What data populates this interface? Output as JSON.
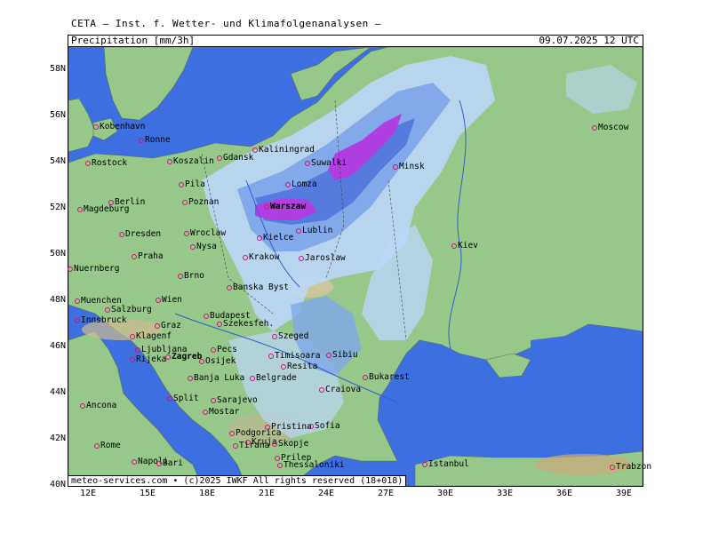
{
  "header": {
    "source": "CETA – Inst. f. Wetter- und Klimafolgenanalysen –",
    "parameter": "Precipitation [mm/3h]",
    "datetime": "09.07.2025 12 UTC"
  },
  "footer": {
    "credit": "meteo-services.com • (c)2025 IWKF All rights reserved (18+018)"
  },
  "axes": {
    "latitudes": [
      "58N",
      "56N",
      "54N",
      "52N",
      "50N",
      "48N",
      "46N",
      "44N",
      "42N",
      "40N"
    ],
    "longitudes": [
      "12E",
      "15E",
      "18E",
      "21E",
      "24E",
      "27E",
      "30E",
      "33E",
      "36E",
      "39E"
    ]
  },
  "cities": [
    {
      "name": "Kobenhavn"
    },
    {
      "name": "Ronne"
    },
    {
      "name": "Rostock"
    },
    {
      "name": "Koszalin"
    },
    {
      "name": "Gdansk"
    },
    {
      "name": "Kaliningrad"
    },
    {
      "name": "Suwalki"
    },
    {
      "name": "Minsk"
    },
    {
      "name": "Moscow"
    },
    {
      "name": "Pila"
    },
    {
      "name": "Berlin"
    },
    {
      "name": "Magdeburg"
    },
    {
      "name": "Poznan"
    },
    {
      "name": "Lomza"
    },
    {
      "name": "Warszaw"
    },
    {
      "name": "Lublin"
    },
    {
      "name": "Dresden"
    },
    {
      "name": "Wroclaw"
    },
    {
      "name": "Kielce"
    },
    {
      "name": "Nysa"
    },
    {
      "name": "Praha"
    },
    {
      "name": "Krakow"
    },
    {
      "name": "Jaroslaw"
    },
    {
      "name": "Kiev"
    },
    {
      "name": "Nuernberg"
    },
    {
      "name": "Brno"
    },
    {
      "name": "Banska Byst"
    },
    {
      "name": "Muenchen"
    },
    {
      "name": "Wien"
    },
    {
      "name": "Salzburg"
    },
    {
      "name": "Innsbruck"
    },
    {
      "name": "Budapest"
    },
    {
      "name": "Szekesfeh."
    },
    {
      "name": "Graz"
    },
    {
      "name": "Klagenf"
    },
    {
      "name": "Szeged"
    },
    {
      "name": "Ljubljana"
    },
    {
      "name": "Pecs"
    },
    {
      "name": "Rijeka"
    },
    {
      "name": "Zagreb"
    },
    {
      "name": "Osijek"
    },
    {
      "name": "Timisoara"
    },
    {
      "name": "Sibiu"
    },
    {
      "name": "Resita"
    },
    {
      "name": "Banja Luka"
    },
    {
      "name": "Belgrade"
    },
    {
      "name": "Bukarest"
    },
    {
      "name": "Craiova"
    },
    {
      "name": "Split"
    },
    {
      "name": "Sarajevo"
    },
    {
      "name": "Ancona"
    },
    {
      "name": "Mostar"
    },
    {
      "name": "Pristina"
    },
    {
      "name": "Sofia"
    },
    {
      "name": "Podgorica"
    },
    {
      "name": "Kruja"
    },
    {
      "name": "Tirana"
    },
    {
      "name": "Skopje"
    },
    {
      "name": "Rome"
    },
    {
      "name": "Prilep"
    },
    {
      "name": "Napoli"
    },
    {
      "name": "Bari"
    },
    {
      "name": "Thessaloniki"
    },
    {
      "name": "Istanbul"
    },
    {
      "name": "Trabzon"
    }
  ],
  "colors": {
    "sea": "#3e6fe0",
    "land": "#96c88a",
    "precip_light": "#bcd6f7",
    "precip_mid": "#7ea7ea",
    "precip_heavy": "#4f76dc",
    "precip_extreme": "#b13ee0"
  }
}
